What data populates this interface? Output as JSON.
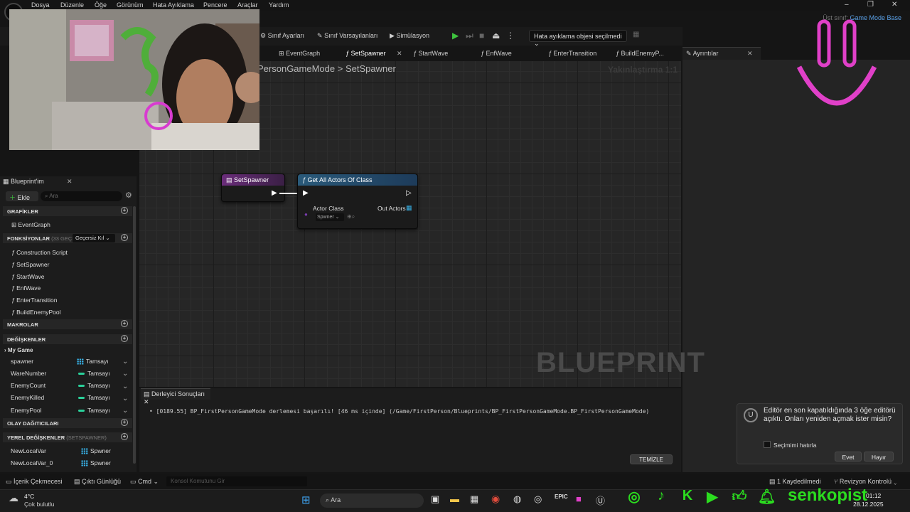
{
  "menu": [
    "Dosya",
    "Düzenle",
    "Öğe",
    "Görünüm",
    "Hata Ayıklama",
    "Pencere",
    "Araçlar",
    "Yardım"
  ],
  "parent_class": {
    "label": "Üst sınıf:",
    "value": "Game Mode Base"
  },
  "toolbar": {
    "class_settings": "Sınıf Ayarları",
    "class_defaults": "Sınıf Varsayılanları",
    "simulation": "Simülasyon",
    "debug_object": "Hata ayıklama objesi seçilmedi"
  },
  "tabs": [
    "EventGraph",
    "SetSpawner",
    "StartWave",
    "EnfWave",
    "EnterTransition",
    "BuildEnemyP..."
  ],
  "details_tab": "Ayrıntılar",
  "breadcrumb": {
    "parent": "PersonGameMode",
    "sep": ">",
    "current": "SetSpawner"
  },
  "zoom": "Yakınlaştırma 1:1",
  "watermark": "BLUEPRINT",
  "nodes": {
    "entry": {
      "title": "SetSpawner"
    },
    "get_all": {
      "title": "Get All Actors Of Class",
      "actor_class": "Actor Class",
      "class_value": "Spwner",
      "out_actors": "Out Actors"
    }
  },
  "blueprint_panel": {
    "tab": "Blueprint'im",
    "add": "Ekle",
    "search_placeholder": "Ara",
    "graphs": {
      "title": "GRAFİKLER",
      "items": [
        "EventGraph"
      ]
    },
    "functions": {
      "title": "FONKSİYONLAR",
      "count": "(33 GEÇE",
      "override": "Geçersiz Kıl",
      "items": [
        "Construction Script",
        "SetSpawner",
        "StartWave",
        "EnfWave",
        "EnterTransition",
        "BuildEnemyPool"
      ]
    },
    "macros": {
      "title": "MAKROLAR"
    },
    "variables": {
      "title": "DEĞİŞKENLER",
      "category": "My Game",
      "items": [
        {
          "name": "spawner",
          "type": "Tamsayı"
        },
        {
          "name": "WareNumber",
          "type": "Tamsayı"
        },
        {
          "name": "EnemyCount",
          "type": "Tamsayı"
        },
        {
          "name": "EnemyKilled",
          "type": "Tamsayı"
        },
        {
          "name": "EnemyPool",
          "type": "Tamsayı"
        }
      ]
    },
    "dispatchers": {
      "title": "OLAY DAĞITICILARI"
    },
    "local_vars": {
      "title": "YEREL DEĞİŞKENLER",
      "scope": "(SETSPAWNER)",
      "items": [
        {
          "name": "NewLocalVar",
          "type": "Spwner"
        },
        {
          "name": "NewLocalVar_0",
          "type": "Spwner"
        }
      ]
    }
  },
  "compiler": {
    "tab": "Derleyici Sonuçları",
    "message": "[0189.55] BP_FirstPersonGameMode derlemesi başarılı! [46 ms içinde] (/Game/FirstPerson/Blueprints/BP_FirstPersonGameMode.BP_FirstPersonGameMode)",
    "clear": "TEMİZLE"
  },
  "bottombar": {
    "content_drawer": "İçerik Çekmecesi",
    "output_log": "Çıktı Günlüğü",
    "cmd": "Cmd",
    "console_placeholder": "Konsol Komutunu Gir",
    "saved": "1 Kaydedilmedi",
    "revision": "Revizyon Kontrolü"
  },
  "notification": {
    "message": "Editör en son kapatıldığında 3 öğe editörü açıktı. Onları yeniden açmak ister misin?",
    "remember": "Seçimimi hatırla",
    "yes": "Evet",
    "no": "Hayır"
  },
  "taskbar": {
    "temp": "4°C",
    "weather": "Çok bulutlu",
    "search": "Ara",
    "time": "01:12",
    "date": "28.12.2025"
  },
  "social": {
    "handle": "senkopist"
  },
  "colors": {
    "accent_green": "#2bdc1f",
    "function_header": "#1d3b5a",
    "entry_header": "#5a2a6a",
    "pink": "#e040c8"
  }
}
